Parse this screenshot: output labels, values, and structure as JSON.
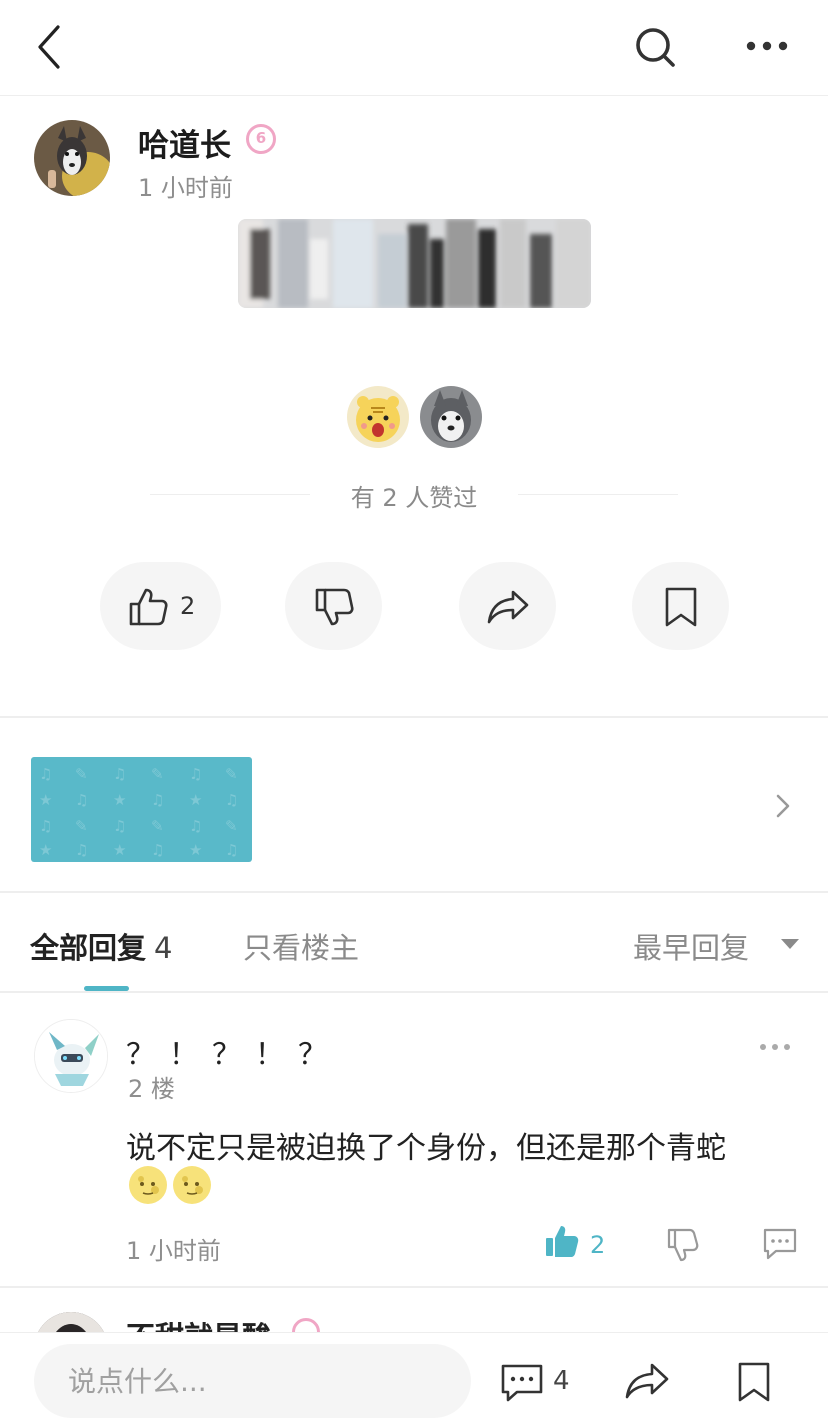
{
  "topbar": {
    "back_icon": "chevron-left-icon",
    "search_icon": "search-icon",
    "more_icon": "more-horizontal-icon"
  },
  "post": {
    "author": "哈道长",
    "level_badge": "6",
    "time": "1 小时前",
    "liked_text": "有 2 人赞过",
    "like_count": "2"
  },
  "replies": {
    "tab_all_label": "全部回复",
    "tab_all_count": "4",
    "tab_owner_label": "只看楼主",
    "sort_label": "最早回复"
  },
  "comments": [
    {
      "name": "？！？！？",
      "floor": "2 楼",
      "text": "说不定只是被迫换了个身份，但还是那个青蛇",
      "time": "1 小时前",
      "like_count": "2"
    },
    {
      "name": "不甜就是酸"
    }
  ],
  "bottombar": {
    "input_placeholder": "说点什么...",
    "comment_count": "4"
  },
  "colors": {
    "accent": "#4fb5c6",
    "banner": "#59b9c9",
    "badge_pink": "#f0a6c5",
    "muted_text": "#8e8e8e"
  }
}
